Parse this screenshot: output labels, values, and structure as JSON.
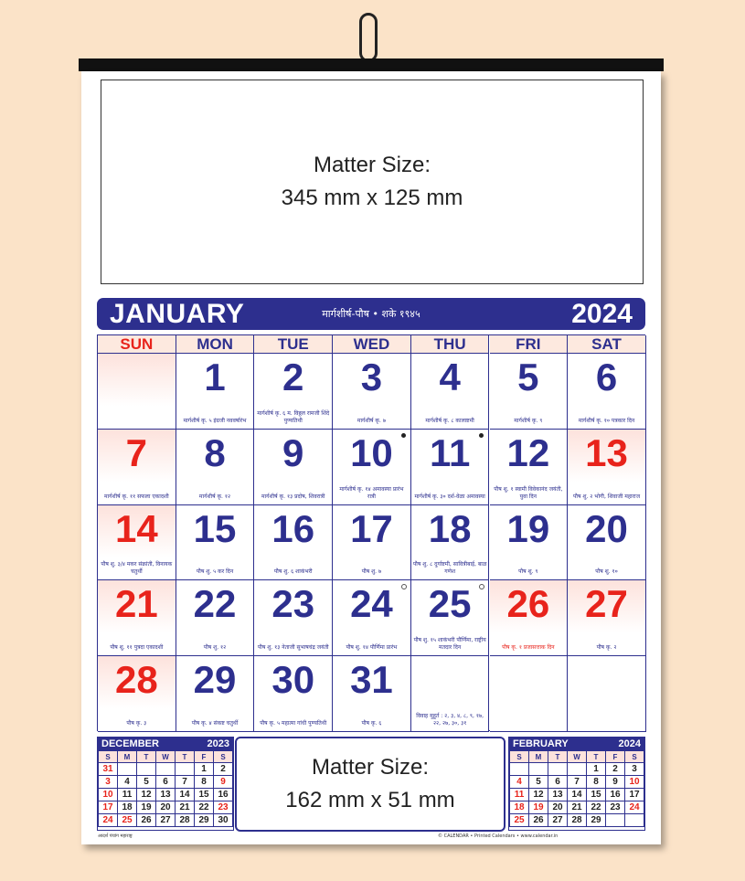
{
  "top_matter": {
    "line1": "Matter Size:",
    "line2": "345 mm x 125 mm"
  },
  "header": {
    "month": "JANUARY",
    "subtitle": "मार्गशीर्ष-पौष • शके १९४५",
    "year": "2024"
  },
  "weekdays": [
    "SUN",
    "MON",
    "TUE",
    "WED",
    "THU",
    "FRI",
    "SAT"
  ],
  "days": [
    {
      "n": "",
      "col": 0,
      "row": 0,
      "red": true,
      "note": ""
    },
    {
      "n": "1",
      "col": 1,
      "row": 0,
      "red": false,
      "note": "मार्गशीर्ष कृ. ५ इंग्रजी नववर्षारंभ"
    },
    {
      "n": "2",
      "col": 2,
      "row": 0,
      "red": false,
      "note": "मार्गशीर्ष कृ. ६ म. विठ्ठल रामजी शिंदे पुण्यतिथी"
    },
    {
      "n": "3",
      "col": 3,
      "row": 0,
      "red": false,
      "note": "मार्गशीर्ष कृ. ७"
    },
    {
      "n": "4",
      "col": 4,
      "row": 0,
      "red": false,
      "note": "मार्गशीर्ष कृ. ८ कालाष्टमी"
    },
    {
      "n": "5",
      "col": 5,
      "row": 0,
      "red": false,
      "note": "मार्गशीर्ष कृ. ९"
    },
    {
      "n": "6",
      "col": 6,
      "row": 0,
      "red": false,
      "note": "मार्गशीर्ष कृ. १० पत्रकार दिन"
    },
    {
      "n": "7",
      "col": 0,
      "row": 1,
      "red": true,
      "note": "मार्गशीर्ष कृ. ११ सफला एकादशी"
    },
    {
      "n": "8",
      "col": 1,
      "row": 1,
      "red": false,
      "note": "मार्गशीर्ष कृ. १२"
    },
    {
      "n": "9",
      "col": 2,
      "row": 1,
      "red": false,
      "note": "मार्गशीर्ष कृ. १३ प्रदोष, शिवरात्री"
    },
    {
      "n": "10",
      "col": 3,
      "row": 1,
      "red": false,
      "note": "मार्गशीर्ष कृ. १४ अमावस्या प्रारंभ रात्री",
      "mark": "dot"
    },
    {
      "n": "11",
      "col": 4,
      "row": 1,
      "red": false,
      "note": "मार्गशीर्ष कृ. ३० दर्श-वेळा अमावस्या",
      "mark": "dot"
    },
    {
      "n": "12",
      "col": 5,
      "row": 1,
      "red": false,
      "note": "पौष शु. १ स्वामी विवेकानंद जयंती, युवा दिन"
    },
    {
      "n": "13",
      "col": 6,
      "row": 1,
      "red": true,
      "note": "पौष शु. २ भोगी, शिवाजी महाराज"
    },
    {
      "n": "14",
      "col": 0,
      "row": 2,
      "red": true,
      "note": "पौष शु. ३/४ मकर संक्रांती, विनायक चतुर्थी"
    },
    {
      "n": "15",
      "col": 1,
      "row": 2,
      "red": false,
      "note": "पौष शु. ५ कर दिन"
    },
    {
      "n": "16",
      "col": 2,
      "row": 2,
      "red": false,
      "note": "पौष शु. ६ शाकंभरी"
    },
    {
      "n": "17",
      "col": 3,
      "row": 2,
      "red": false,
      "note": "पौष शु. ७"
    },
    {
      "n": "18",
      "col": 4,
      "row": 2,
      "red": false,
      "note": "पौष शु. ८ दुर्गाष्टमी, सावित्रीबाई, बाळ गणेश"
    },
    {
      "n": "19",
      "col": 5,
      "row": 2,
      "red": false,
      "note": "पौष शु. ९"
    },
    {
      "n": "20",
      "col": 6,
      "row": 2,
      "red": false,
      "note": "पौष शु. १०"
    },
    {
      "n": "21",
      "col": 0,
      "row": 3,
      "red": true,
      "note": "पौष शु. ११ पुत्रदा एकादशी"
    },
    {
      "n": "22",
      "col": 1,
      "row": 3,
      "red": false,
      "note": "पौष शु. १२"
    },
    {
      "n": "23",
      "col": 2,
      "row": 3,
      "red": false,
      "note": "पौष शु. १३ नेताजी सुभाषचंद्र जयंती"
    },
    {
      "n": "24",
      "col": 3,
      "row": 3,
      "red": false,
      "note": "पौष शु. १४ पौर्णिमा प्रारंभ",
      "mark": "ring"
    },
    {
      "n": "25",
      "col": 4,
      "row": 3,
      "red": false,
      "note": "पौष शु. १५ शाकंभरी पौर्णिमा, राष्ट्रीय मतदार दिन",
      "mark": "ring"
    },
    {
      "n": "26",
      "col": 5,
      "row": 3,
      "red": true,
      "note": "पौष कृ. १ प्रजासत्ताक दिन",
      "note_red": true
    },
    {
      "n": "27",
      "col": 6,
      "row": 3,
      "red": true,
      "note": "पौष कृ. २"
    },
    {
      "n": "28",
      "col": 0,
      "row": 4,
      "red": true,
      "note": "पौष कृ. ३"
    },
    {
      "n": "29",
      "col": 1,
      "row": 4,
      "red": false,
      "note": "पौष कृ. ४ संकष्ट चतुर्थी"
    },
    {
      "n": "30",
      "col": 2,
      "row": 4,
      "red": false,
      "note": "पौष कृ. ५ महात्मा गांधी पुण्यतिथी"
    },
    {
      "n": "31",
      "col": 3,
      "row": 4,
      "red": false,
      "note": "पौष कृ. ६"
    },
    {
      "n": "",
      "col": 4,
      "row": 4,
      "red": false,
      "note": "विवाह मुहूर्त : २, ३, ४, ८, ९, १७, २२, २७, ३०, ३१"
    },
    {
      "n": "",
      "col": 5,
      "row": 4,
      "red": false,
      "note": ""
    },
    {
      "n": "",
      "col": 6,
      "row": 4,
      "red": false,
      "note": ""
    }
  ],
  "mini_prev": {
    "title": "DECEMBER",
    "year": "2023",
    "weekdays": [
      "S",
      "M",
      "T",
      "W",
      "T",
      "F",
      "S"
    ],
    "rows": [
      [
        "31",
        "",
        "",
        "",
        "",
        "1",
        "2"
      ],
      [
        "3",
        "4",
        "5",
        "6",
        "7",
        "8",
        "9"
      ],
      [
        "10",
        "11",
        "12",
        "13",
        "14",
        "15",
        "16"
      ],
      [
        "17",
        "18",
        "19",
        "20",
        "21",
        "22",
        "23"
      ],
      [
        "24",
        "25",
        "26",
        "27",
        "28",
        "29",
        "30"
      ]
    ]
  },
  "mini_next": {
    "title": "FEBRUARY",
    "year": "2024",
    "weekdays": [
      "S",
      "M",
      "T",
      "W",
      "T",
      "F",
      "S"
    ],
    "rows": [
      [
        "",
        "",
        "",
        "",
        "1",
        "2",
        "3"
      ],
      [
        "4",
        "5",
        "6",
        "7",
        "8",
        "9",
        "10"
      ],
      [
        "11",
        "12",
        "13",
        "14",
        "15",
        "16",
        "17"
      ],
      [
        "18",
        "19",
        "20",
        "21",
        "22",
        "23",
        "24"
      ],
      [
        "25",
        "26",
        "27",
        "28",
        "29",
        "",
        ""
      ]
    ]
  },
  "bottom_matter": {
    "line1": "Matter Size:",
    "line2": "162 mm x 51 mm"
  },
  "footer": {
    "left": "आदर्श पंचांग महाराष्ट्र",
    "right": "© CALENDAR • Printed Calendars • www.calendar.in"
  }
}
